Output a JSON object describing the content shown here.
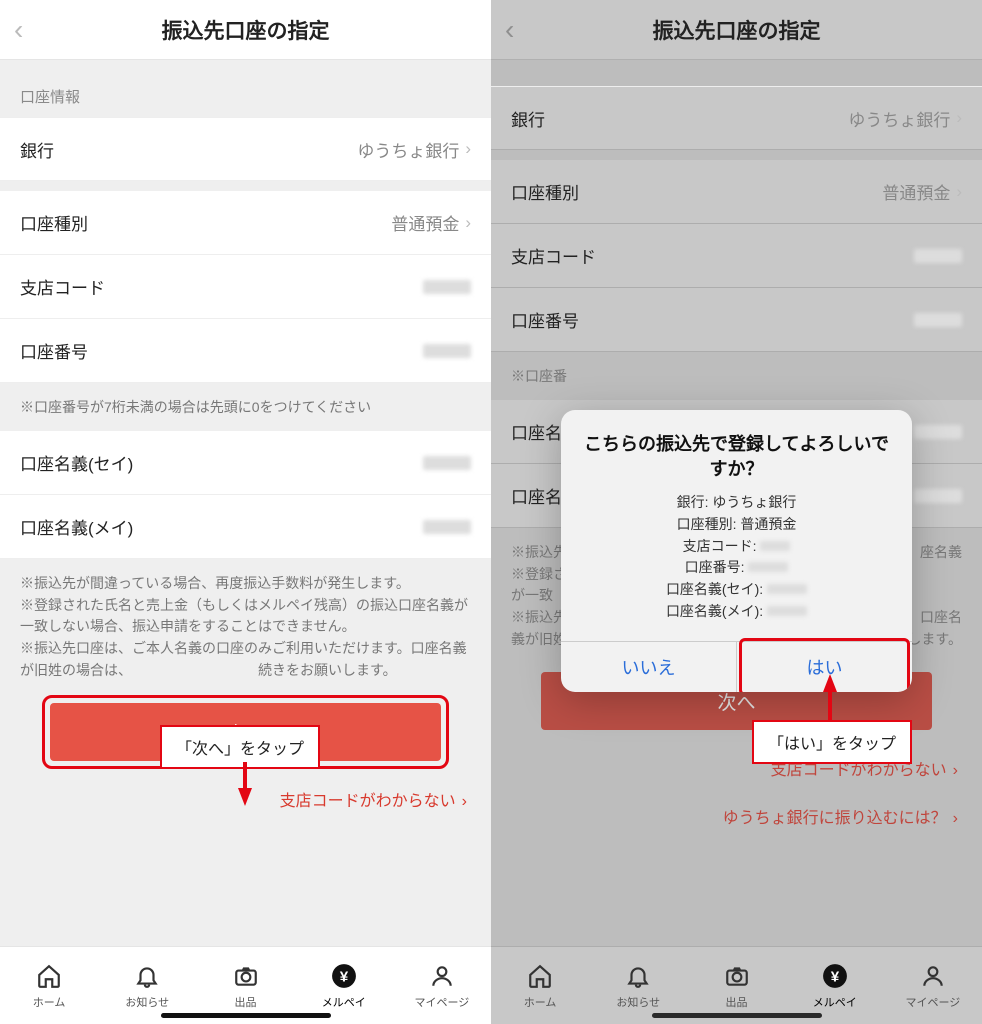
{
  "left": {
    "header_title": "振込先口座の指定",
    "section_header": "口座情報",
    "rows": {
      "bank_label": "銀行",
      "bank_value": "ゆうちょ銀行",
      "account_type_label": "口座種別",
      "account_type_value": "普通預金",
      "branch_code_label": "支店コード",
      "account_number_label": "口座番号",
      "account_name_sei_label": "口座名義(セイ)",
      "account_name_mei_label": "口座名義(メイ)"
    },
    "note": "※口座番号が7桁未満の場合は先頭に0をつけてください",
    "disclaimer_l1": "※振込先が間違っている場合、再度振込手数料が発生します。",
    "disclaimer_l2": "※登録された氏名と売上金（もしくはメルペイ残高）の振込口座名義が一致しない場合、振込申請をすることはできません。",
    "disclaimer_l3": "※振込先口座は、ご本人名義の口座のみご利用いただけます。口座名義が旧姓の場合は、",
    "disclaimer_l3b": "続きをお願いします。",
    "primary_button": "次へ",
    "callout": "「次へ」をタップ",
    "link1": "支店コードがわからない",
    "tabs": {
      "home": "ホーム",
      "notify": "お知らせ",
      "sell": "出品",
      "merpay": "メルペイ",
      "mypage": "マイページ"
    }
  },
  "right": {
    "header_title": "振込先口座の指定",
    "rows": {
      "bank_label": "銀行",
      "bank_value": "ゆうちょ銀行",
      "account_type_label": "口座種別",
      "account_type_value": "普通預金",
      "branch_code_label": "支店コード",
      "account_number_label": "口座番号",
      "account_number_note": "※口座番",
      "account_name_sei_prefix": "口座名",
      "account_name_mei_prefix": "口座名"
    },
    "disclaimer_l1": "※振込先",
    "disclaimer_l1b": "座名義",
    "disclaimer_l2": "※登録さ",
    "disclaimer_l2b": "が一致",
    "disclaimer_l3": "※振込先",
    "disclaimer_l3b": "口座名",
    "disclaimer_l4": "義が旧姓の",
    "disclaimer_l4b": "します。",
    "primary_button": "次へ",
    "callout": "「はい」をタップ",
    "link1": "支店コードがわからない",
    "link2": "ゆうちょ銀行に振り込むには？",
    "modal": {
      "title": "こちらの振込先で登録してよろしいですか？",
      "line_bank": "銀行: ゆうちょ銀行",
      "line_type": "口座種別: 普通預金",
      "line_branch": "支店コード:",
      "line_number": "口座番号:",
      "line_sei": "口座名義(セイ):",
      "line_mei": "口座名義(メイ):",
      "no": "いいえ",
      "yes": "はい"
    },
    "tabs": {
      "home": "ホーム",
      "notify": "お知らせ",
      "sell": "出品",
      "merpay": "メルペイ",
      "mypage": "マイページ"
    }
  }
}
